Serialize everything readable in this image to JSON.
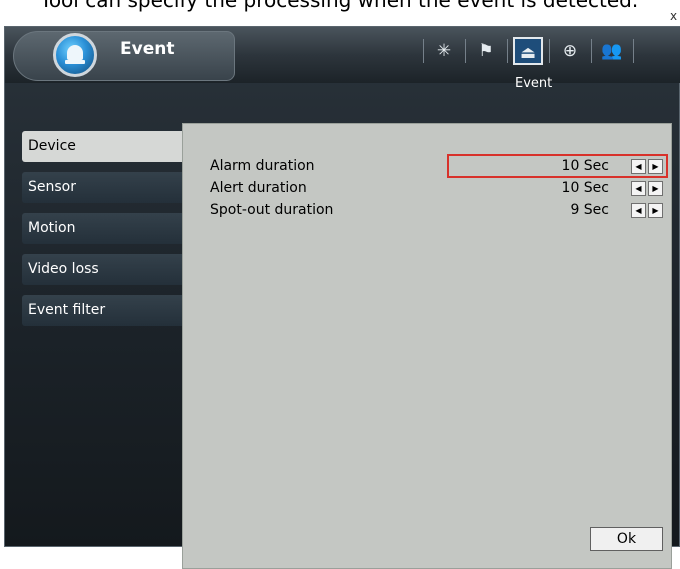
{
  "top_strip": {
    "cut_text": "Tool can specify the processing when the event is detected.",
    "close": "x"
  },
  "header": {
    "title": "Event",
    "section_title": "Event",
    "toolbar": [
      {
        "icon": "spinner-icon",
        "glyph": "✳"
      },
      {
        "icon": "flag-icon",
        "glyph": "⚑"
      },
      {
        "icon": "alarm-bell-icon",
        "glyph": "⏏"
      },
      {
        "icon": "globe-icon",
        "glyph": "⊕"
      },
      {
        "icon": "users-icon",
        "glyph": "👥"
      }
    ]
  },
  "sidebar": {
    "items": [
      {
        "label": "Device",
        "active": true
      },
      {
        "label": "Sensor",
        "active": false
      },
      {
        "label": "Motion",
        "active": false
      },
      {
        "label": "Video loss",
        "active": false
      },
      {
        "label": "Event filter",
        "active": false
      }
    ]
  },
  "settings": [
    {
      "label": "Alarm duration",
      "value": "10 Sec"
    },
    {
      "label": "Alert duration",
      "value": "10 Sec"
    },
    {
      "label": "Spot-out duration",
      "value": "9 Sec"
    }
  ],
  "ok_label": "Ok",
  "colors": {
    "highlight": "#d8312a",
    "active_toolbar": "#1e4d7a"
  }
}
